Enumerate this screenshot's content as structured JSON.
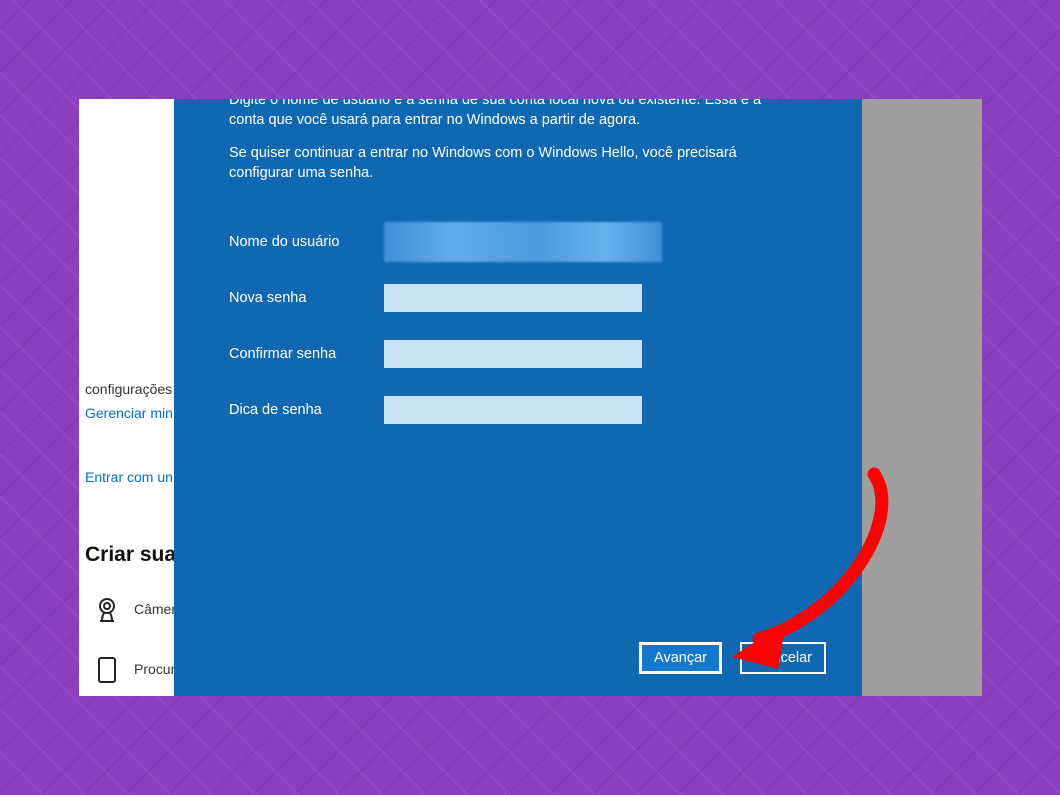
{
  "dialog": {
    "paragraph1_cut": "Digite o nome de usuário e a senha de sua conta local nova ou existente. Essa é a conta que você usará para entrar no Windows a partir de agora.",
    "paragraph2": "Se quiser continuar a entrar no Windows com o Windows Hello, você precisará configurar uma senha.",
    "labels": {
      "username": "Nome do usuário",
      "new_password": "Nova senha",
      "confirm_password": "Confirmar senha",
      "password_hint": "Dica de senha"
    },
    "values": {
      "new_password": "",
      "confirm_password": "",
      "password_hint": ""
    },
    "buttons": {
      "next": "Avançar",
      "cancel": "Cancelar"
    }
  },
  "settings_bg": {
    "line_configurations": "configurações",
    "link_manage": "Gerenciar min",
    "link_signin": "Entrar com un",
    "heading_create": "Criar sua i",
    "item_camera": "Câmer",
    "item_browse": "Procur"
  },
  "annotation": {
    "arrow_target": "next-button",
    "arrow_color": "#ff0000"
  }
}
